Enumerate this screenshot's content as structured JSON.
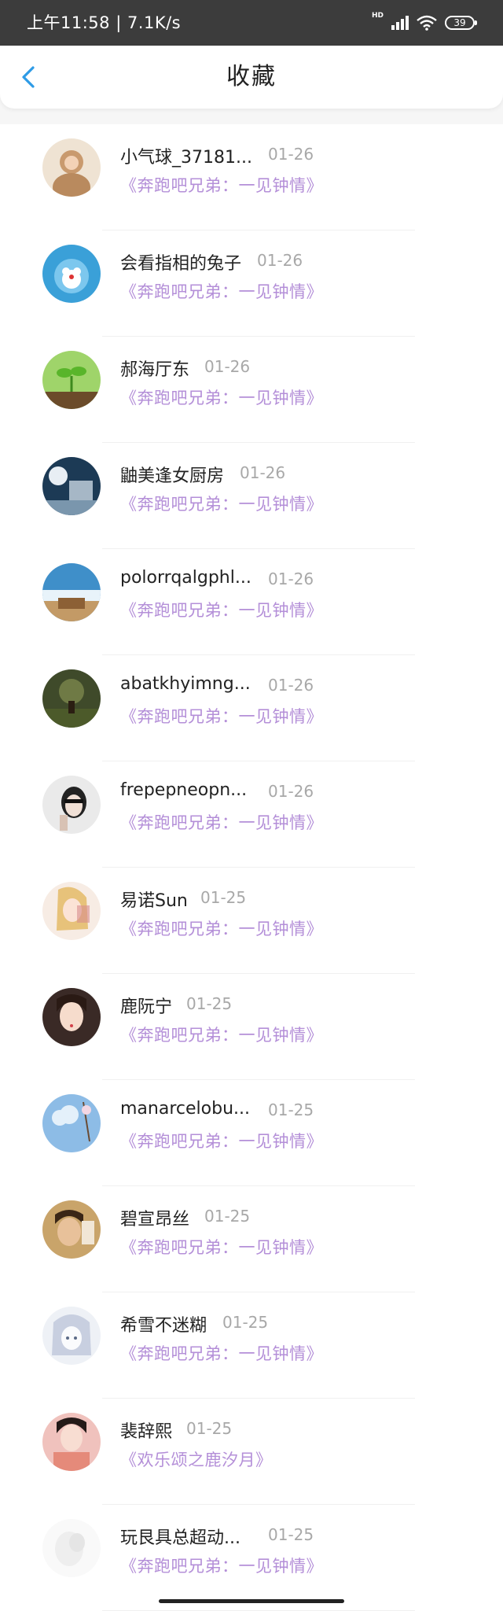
{
  "status_bar": {
    "time": "上午11:58 | 7.1K/s",
    "hd": "HD",
    "battery": "39"
  },
  "header": {
    "title": "收藏",
    "back_icon": "chevron-left-icon"
  },
  "colors": {
    "accent": "#2e9be6",
    "show_title": "#b48fd8",
    "date": "#a8a8a8"
  },
  "favorites": [
    {
      "name": "小气球_37181...",
      "date": "01-26",
      "show": "《奔跑吧兄弟：一见钟情》"
    },
    {
      "name": "会看指相的兔子",
      "date": "01-26",
      "show": "《奔跑吧兄弟：一见钟情》"
    },
    {
      "name": "郝海厅东",
      "date": "01-26",
      "show": "《奔跑吧兄弟：一见钟情》"
    },
    {
      "name": "鼬美逢女厨房",
      "date": "01-26",
      "show": "《奔跑吧兄弟：一见钟情》"
    },
    {
      "name": "polorrqalgphl...",
      "date": "01-26",
      "show": "《奔跑吧兄弟：一见钟情》"
    },
    {
      "name": "abatkhyimng...",
      "date": "01-26",
      "show": "《奔跑吧兄弟：一见钟情》"
    },
    {
      "name": "frepepneopn...",
      "date": "01-26",
      "show": "《奔跑吧兄弟：一见钟情》"
    },
    {
      "name": "易诺Sun",
      "date": "01-25",
      "show": "《奔跑吧兄弟：一见钟情》"
    },
    {
      "name": "鹿阮宁",
      "date": "01-25",
      "show": "《奔跑吧兄弟：一见钟情》"
    },
    {
      "name": "manarcelobu...",
      "date": "01-25",
      "show": "《奔跑吧兄弟：一见钟情》"
    },
    {
      "name": "碧宣昂丝",
      "date": "01-25",
      "show": "《奔跑吧兄弟：一见钟情》"
    },
    {
      "name": "希雪不迷糊",
      "date": "01-25",
      "show": "《奔跑吧兄弟：一见钟情》"
    },
    {
      "name": "裴辞熙",
      "date": "01-25",
      "show": "《欢乐颂之鹿汐月》"
    },
    {
      "name": "玩艮具总超动...",
      "date": "01-25",
      "show": "《奔跑吧兄弟：一见钟情》"
    }
  ]
}
